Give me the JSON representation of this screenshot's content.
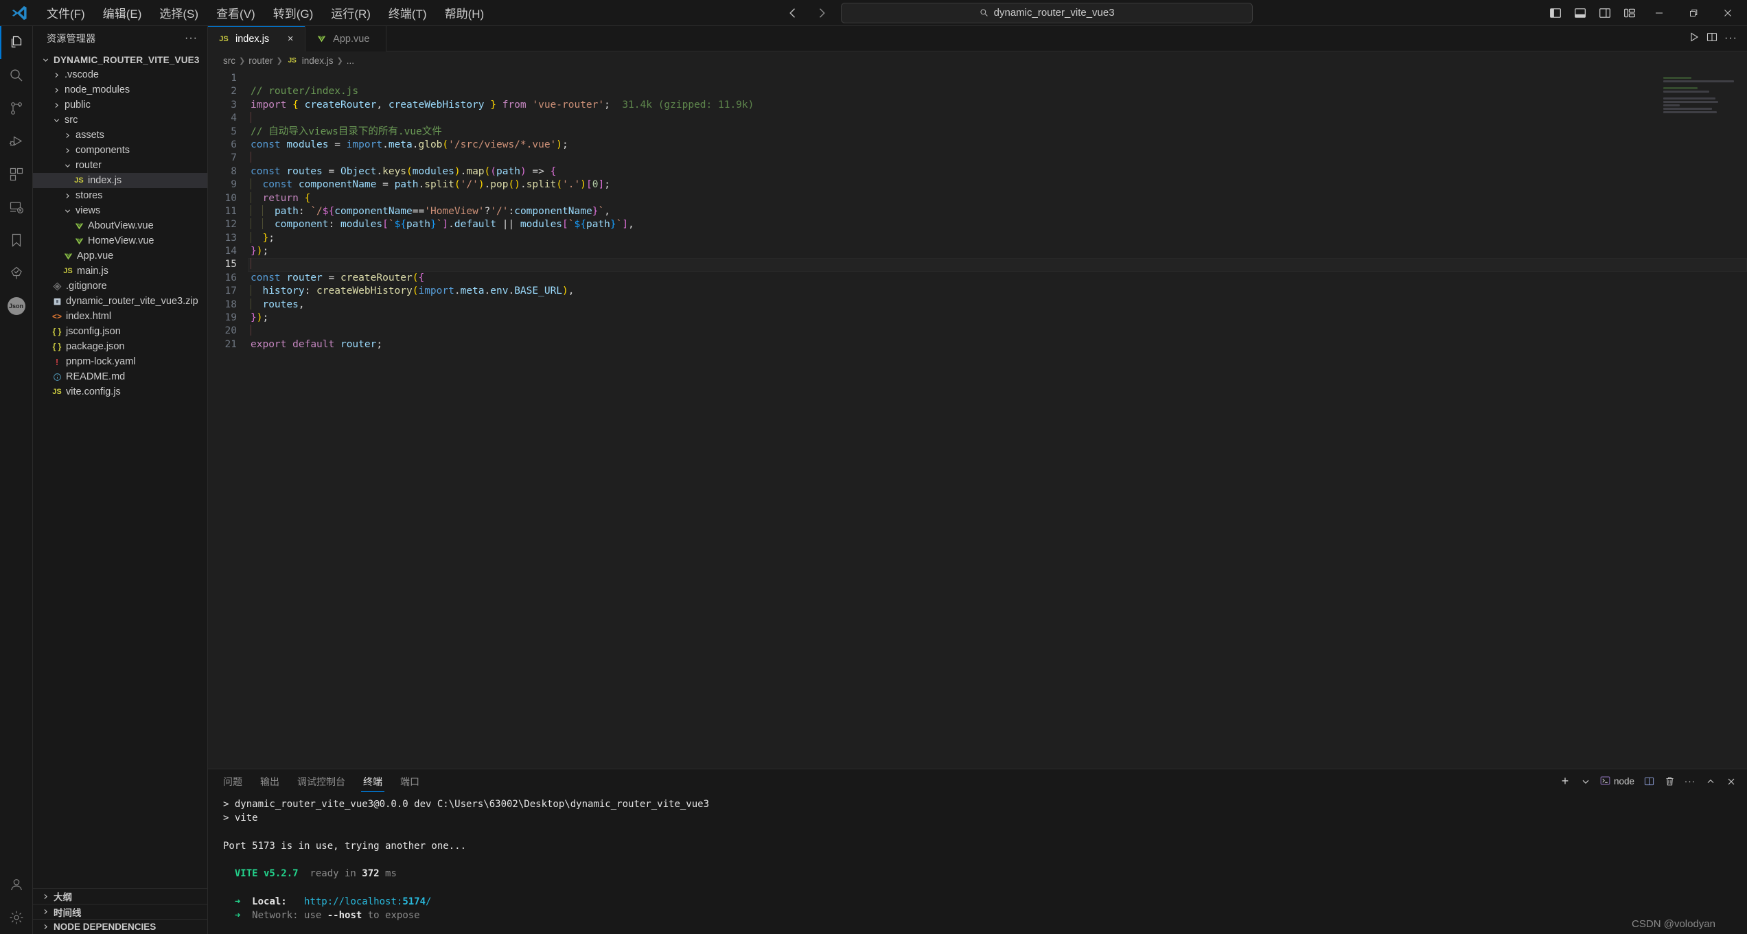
{
  "titlebar": {
    "logo": "vscode-logo",
    "menu": [
      "文件(F)",
      "编辑(E)",
      "选择(S)",
      "查看(V)",
      "转到(G)",
      "运行(R)",
      "终端(T)",
      "帮助(H)"
    ],
    "nav_back": "back-arrow",
    "nav_forward": "forward-arrow",
    "search_value": "dynamic_router_vite_vue3",
    "layout_icons": [
      "toggle-primary-sidebar",
      "toggle-panel",
      "toggle-secondary-sidebar",
      "customize-layout"
    ],
    "window_controls": [
      "minimize",
      "restore",
      "close"
    ]
  },
  "activitybar": {
    "items": [
      {
        "name": "explorer",
        "icon": "files-icon",
        "active": true
      },
      {
        "name": "search",
        "icon": "search-icon",
        "active": false
      },
      {
        "name": "source-control",
        "icon": "source-control-icon",
        "active": false
      },
      {
        "name": "run-and-debug",
        "icon": "debug-icon",
        "active": false
      },
      {
        "name": "extensions",
        "icon": "extensions-icon",
        "active": false
      },
      {
        "name": "remote-explorer",
        "icon": "remote-icon",
        "active": false
      },
      {
        "name": "bookmarks",
        "icon": "bookmark-icon",
        "active": false
      },
      {
        "name": "test-explorer",
        "icon": "tree-check-icon",
        "active": false
      },
      {
        "name": "json-badge",
        "icon": "json-icon",
        "label": "Json",
        "active": false
      }
    ],
    "bottom": [
      {
        "name": "accounts",
        "icon": "account-icon"
      },
      {
        "name": "settings",
        "icon": "gear-icon"
      }
    ]
  },
  "sidebar": {
    "title": "资源管理器",
    "more_actions": "···",
    "root": "DYNAMIC_ROUTER_VITE_VUE3",
    "tree": [
      {
        "label": ".vscode",
        "type": "folder",
        "open": false,
        "depth": 1
      },
      {
        "label": "node_modules",
        "type": "folder",
        "open": false,
        "depth": 1
      },
      {
        "label": "public",
        "type": "folder",
        "open": false,
        "depth": 1
      },
      {
        "label": "src",
        "type": "folder",
        "open": true,
        "depth": 1
      },
      {
        "label": "assets",
        "type": "folder",
        "open": false,
        "depth": 2
      },
      {
        "label": "components",
        "type": "folder",
        "open": false,
        "depth": 2
      },
      {
        "label": "router",
        "type": "folder",
        "open": true,
        "depth": 2
      },
      {
        "label": "index.js",
        "type": "js",
        "depth": 3,
        "selected": true
      },
      {
        "label": "stores",
        "type": "folder",
        "open": false,
        "depth": 2
      },
      {
        "label": "views",
        "type": "folder",
        "open": true,
        "depth": 2
      },
      {
        "label": "AboutView.vue",
        "type": "vue",
        "depth": 3
      },
      {
        "label": "HomeView.vue",
        "type": "vue",
        "depth": 3
      },
      {
        "label": "App.vue",
        "type": "vue",
        "depth": 2
      },
      {
        "label": "main.js",
        "type": "js",
        "depth": 2
      },
      {
        "label": ".gitignore",
        "type": "git",
        "depth": 1
      },
      {
        "label": "dynamic_router_vite_vue3.zip",
        "type": "zip",
        "depth": 1
      },
      {
        "label": "index.html",
        "type": "html",
        "depth": 1
      },
      {
        "label": "jsconfig.json",
        "type": "json",
        "depth": 1
      },
      {
        "label": "package.json",
        "type": "json",
        "depth": 1
      },
      {
        "label": "pnpm-lock.yaml",
        "type": "yaml",
        "depth": 1
      },
      {
        "label": "README.md",
        "type": "md",
        "depth": 1
      },
      {
        "label": "vite.config.js",
        "type": "js",
        "depth": 1
      }
    ],
    "sections": [
      {
        "label": "大纲",
        "open": false
      },
      {
        "label": "时间线",
        "open": false
      },
      {
        "label": "NODE DEPENDENCIES",
        "open": false
      }
    ]
  },
  "editor": {
    "tabs": [
      {
        "label": "index.js",
        "icon": "js-file-icon",
        "active": true,
        "close": "×"
      },
      {
        "label": "App.vue",
        "icon": "vue-file-icon",
        "active": false
      }
    ],
    "actions": [
      "run-icon",
      "split-editor-icon",
      "more-actions-icon"
    ],
    "breadcrumb": [
      "src",
      "router",
      "index.js",
      "..."
    ],
    "breadcrumb_file_icon": "js-file-icon",
    "line_numbers": [
      1,
      2,
      3,
      4,
      5,
      6,
      7,
      8,
      9,
      10,
      11,
      12,
      13,
      14,
      15,
      16,
      17,
      18,
      19,
      20,
      21
    ],
    "current_line": 15,
    "code": [
      "",
      "// router/index.js",
      "import { createRouter, createWebHistory } from 'vue-router';",
      "",
      "// 自动导入views目录下的所有.vue文件",
      "const modules = import.meta.glob('/src/views/*.vue');",
      "",
      "const routes = Object.keys(modules).map((path) => {",
      "  const componentName = path.split('/').pop().split('.')[0];",
      "  return {",
      "    path: `/${componentName=='HomeView'?'/':componentName}`,",
      "    component: modules[`${path}`].default || modules[`${path}`],",
      "  };",
      "});",
      "",
      "const router = createRouter({",
      "  history: createWebHistory(import.meta.env.BASE_URL),",
      "  routes,",
      "});",
      "",
      "export default router;"
    ],
    "import_hint": "31.4k (gzipped: 11.9k)"
  },
  "panel": {
    "tabs": [
      {
        "label": "问题",
        "active": false
      },
      {
        "label": "输出",
        "active": false
      },
      {
        "label": "调试控制台",
        "active": false
      },
      {
        "label": "终端",
        "active": true
      },
      {
        "label": "端口",
        "active": false
      }
    ],
    "actions": {
      "new_terminal": "+",
      "dropdown": "chevron-down-icon",
      "shell_icon": "terminal-icon",
      "shell_label": "node",
      "split": "split-terminal-icon",
      "kill": "trash-icon",
      "more": "···",
      "maximize": "chevron-up-icon",
      "close": "close-icon"
    },
    "terminal_lines": [
      {
        "segments": [
          {
            "t": "> dynamic_router_vite_vue3@0.0.0 dev C:\\Users\\63002\\Desktop\\dynamic_router_vite_vue3",
            "c": "t-w"
          }
        ]
      },
      {
        "segments": [
          {
            "t": "> vite",
            "c": "t-w"
          }
        ]
      },
      {
        "segments": [
          {
            "t": "",
            "c": "t-w"
          }
        ]
      },
      {
        "segments": [
          {
            "t": "Port 5173 is in use, trying another one...",
            "c": "t-w"
          }
        ]
      },
      {
        "segments": [
          {
            "t": "",
            "c": "t-w"
          }
        ]
      },
      {
        "segments": [
          {
            "t": "  VITE v5.2.7",
            "c": "t-green t-bold"
          },
          {
            "t": "  ready in ",
            "c": "t-dim"
          },
          {
            "t": "372",
            "c": "t-w t-bold"
          },
          {
            "t": " ms",
            "c": "t-dim"
          }
        ]
      },
      {
        "segments": [
          {
            "t": "",
            "c": "t-w"
          }
        ]
      },
      {
        "segments": [
          {
            "t": "  ➜",
            "c": "t-green"
          },
          {
            "t": "  Local:",
            "c": "t-w t-bold"
          },
          {
            "t": "   http://localhost:",
            "c": "t-cyan"
          },
          {
            "t": "5174",
            "c": "t-cyan t-bold"
          },
          {
            "t": "/",
            "c": "t-cyan"
          }
        ]
      },
      {
        "segments": [
          {
            "t": "  ➜",
            "c": "t-green"
          },
          {
            "t": "  Network: use ",
            "c": "t-dim"
          },
          {
            "t": "--host",
            "c": "t-w t-bold"
          },
          {
            "t": " to expose",
            "c": "t-dim"
          }
        ]
      }
    ]
  },
  "watermark": "CSDN @volodyan",
  "colors": {
    "accent": "#0078d4",
    "background": "#1f1f1f",
    "sidebar_bg": "#181818",
    "selection": "#2f2f33",
    "js_icon": "#cbcb41",
    "vue_icon": "#8dc149",
    "json_icon": "#cbcb41",
    "html_icon": "#e37933",
    "md_icon": "#519aba",
    "yaml_icon": "#cc3e44"
  }
}
